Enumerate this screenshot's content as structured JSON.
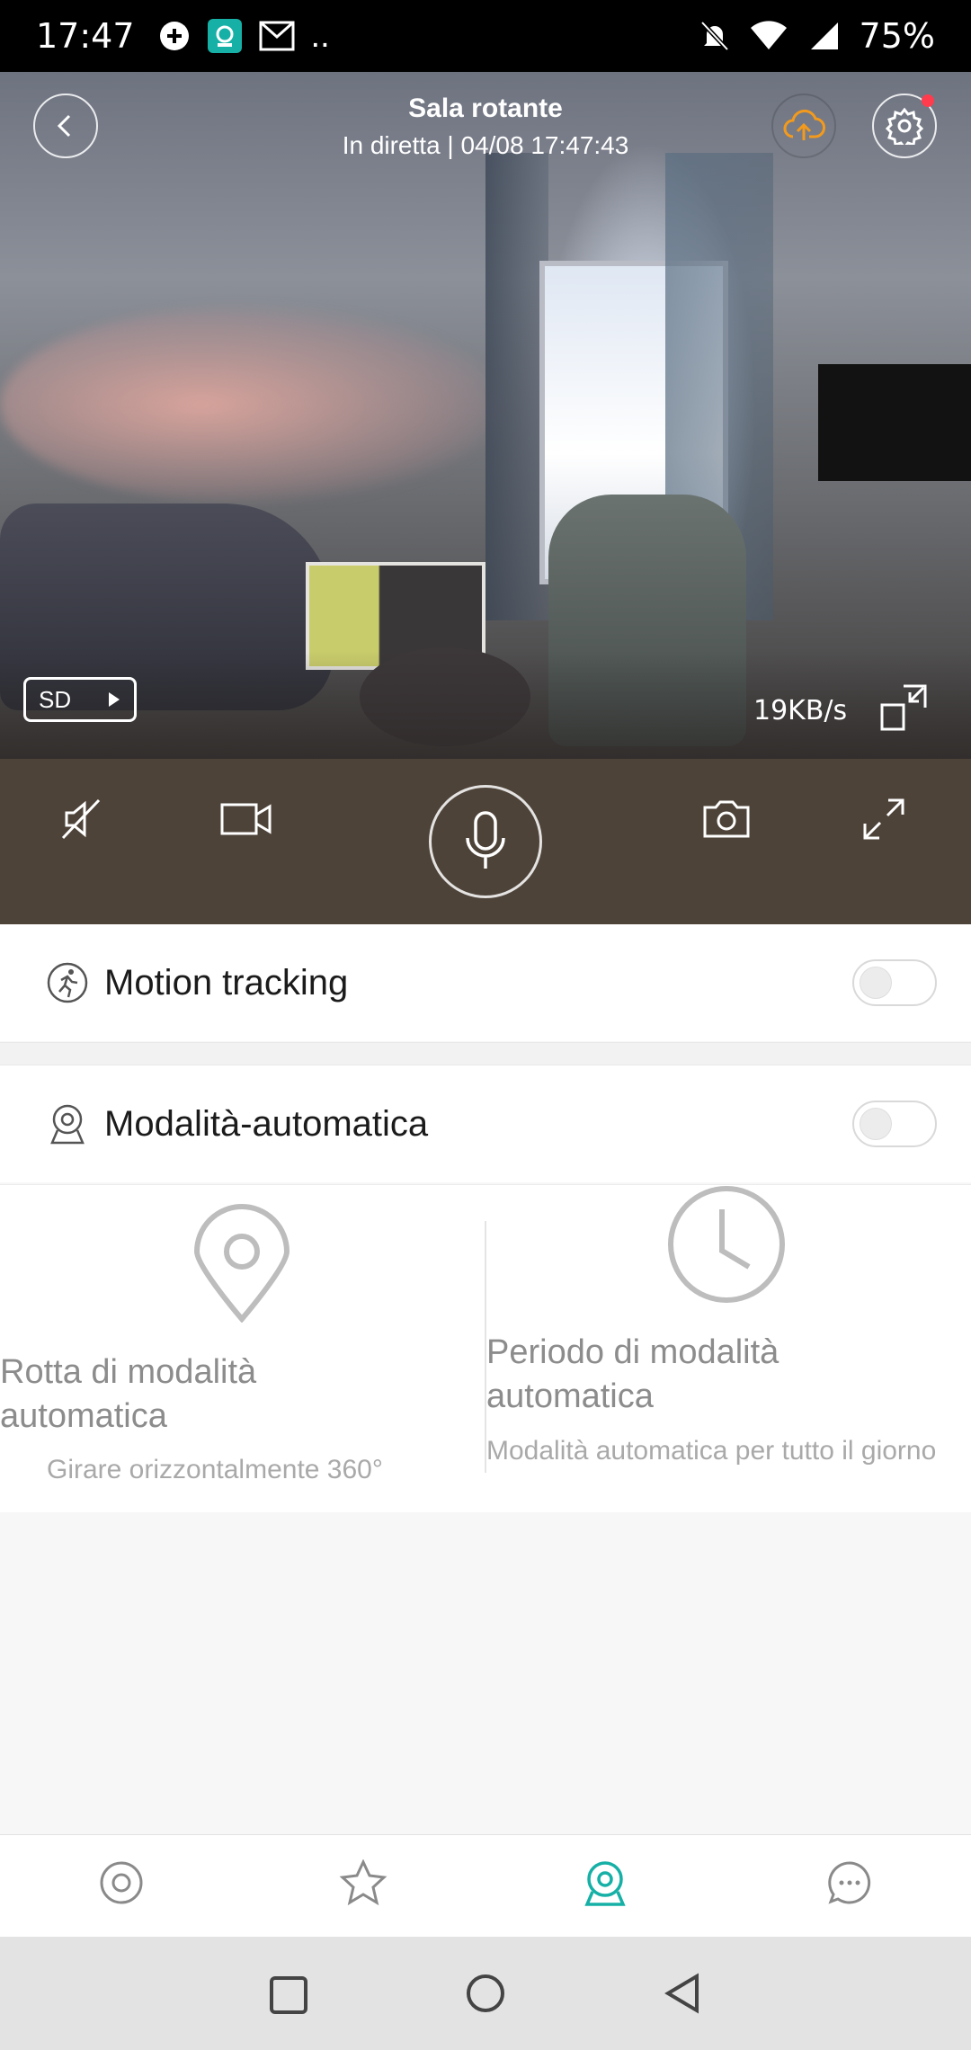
{
  "status_bar": {
    "time": "17:47",
    "battery_percent": "75%",
    "notification_icons": [
      "plus-badge-icon",
      "camera-app-icon",
      "gmail-icon",
      "more-dots-icon"
    ],
    "system_icons": [
      "mute-bell-icon",
      "wifi-icon",
      "cell-signal-icon"
    ],
    "more": ".."
  },
  "camera": {
    "title": "Sala rotante",
    "live_status": "In diretta | 04/08 17:47:43",
    "quality_badge": "SD",
    "bitrate": "19KB/s",
    "settings_has_notification": true,
    "accent_color": "#f39a1c",
    "notification_dot_color": "#ff3b4e"
  },
  "controls": {
    "items": [
      "mute-icon",
      "record-video-icon",
      "microphone-icon",
      "screenshot-icon",
      "fullscreen-icon"
    ],
    "bar_color": "#4e4339"
  },
  "settings": {
    "motion_tracking": {
      "label": "Motion tracking",
      "enabled": false
    },
    "auto_mode": {
      "label": "Modalità-automatica",
      "enabled": false
    }
  },
  "auto_panels": {
    "route": {
      "title": "Rotta di modalità automatica",
      "subtitle": "Girare orizzontalmente 360°"
    },
    "period": {
      "title": "Periodo di modalità automatica",
      "subtitle": "Modalità automatica per tutto il giorno"
    }
  },
  "bottom_nav": {
    "items": [
      "home-ring-icon",
      "favorites-star-icon",
      "camera-tab-icon",
      "messages-icon"
    ],
    "active_index": 2,
    "active_color": "#16b0a6"
  },
  "system_nav": {
    "items": [
      "recents-square-icon",
      "home-circle-icon",
      "back-triangle-icon"
    ]
  }
}
